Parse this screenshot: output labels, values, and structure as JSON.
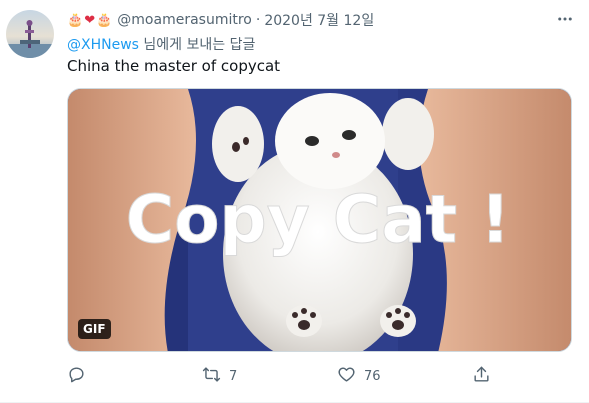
{
  "tweet": {
    "emojis": [
      "🎂",
      "❤",
      "🎂"
    ],
    "handle": "@moamerasumitro",
    "separator": "·",
    "date": "2020년 7월 12일",
    "reply_mention": "@XHNews",
    "reply_suffix": " 님에게 보내는 답글",
    "text": "China the master of copycat",
    "media": {
      "overlay_text": "Copy Cat !",
      "badge": "GIF"
    },
    "actions": {
      "reply_count": "",
      "retweet_count": "7",
      "like_count": "76"
    },
    "icons": {
      "more": "more-icon",
      "reply": "reply-icon",
      "retweet": "retweet-icon",
      "like": "heart-icon",
      "share": "share-icon"
    },
    "colors": {
      "link": "#1d9bf0",
      "secondary": "#536471",
      "heart": "#e0245e"
    }
  }
}
